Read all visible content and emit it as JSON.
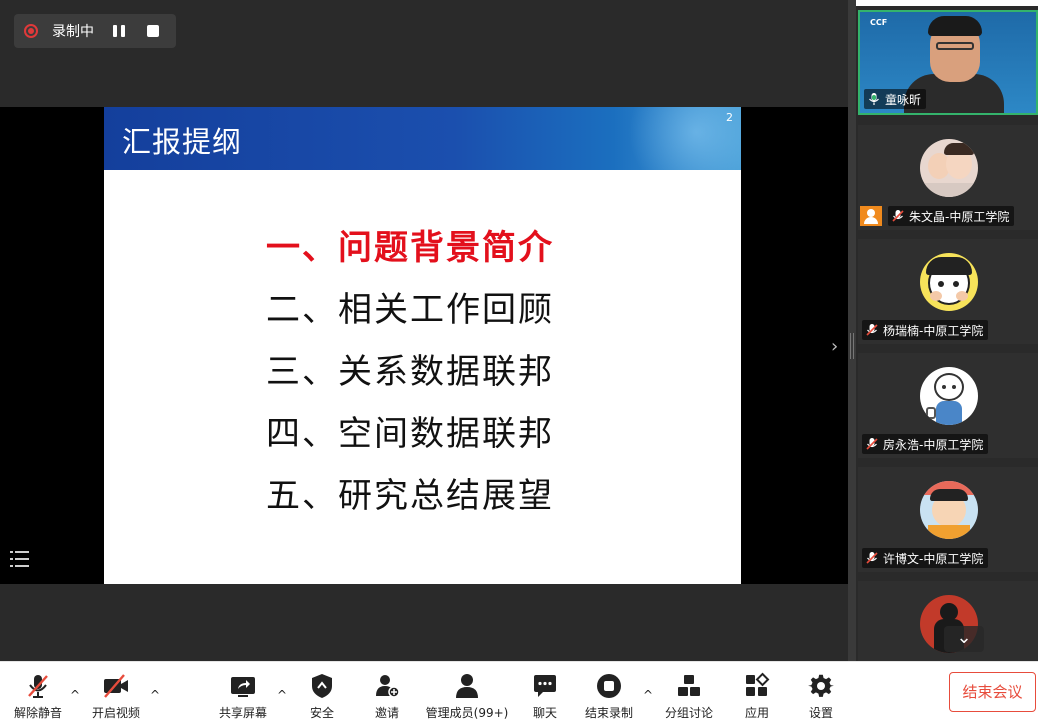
{
  "recording": {
    "status_label": "录制中",
    "pause_icon": "pause-icon",
    "stop_icon": "stop-icon",
    "indicator_color": "#e0393a"
  },
  "slide": {
    "title": "汇报提纲",
    "page_number": "2",
    "items": [
      {
        "text": "一、问题背景简介",
        "active": true
      },
      {
        "text": "二、相关工作回顾",
        "active": false
      },
      {
        "text": "三、关系数据联邦",
        "active": false
      },
      {
        "text": "四、空间数据联邦",
        "active": false
      },
      {
        "text": "五、研究总结展望",
        "active": false
      }
    ],
    "active_color": "#e3101c",
    "header_color": "#1b4fae"
  },
  "participants": [
    {
      "name": "童咏昕",
      "mic": "on",
      "speaking": true,
      "logo_text": "CCF"
    },
    {
      "name": "朱文晶-中原工学院",
      "mic": "muted",
      "host": true
    },
    {
      "name": "杨瑞楠-中原工学院",
      "mic": "muted"
    },
    {
      "name": "房永浩-中原工学院",
      "mic": "muted"
    },
    {
      "name": "许博文-中原工学院",
      "mic": "muted"
    }
  ],
  "toolbar": {
    "unmute": "解除静音",
    "start_video": "开启视频",
    "share_screen": "共享屏幕",
    "security": "安全",
    "invite": "邀请",
    "manage_members": "管理成员(99+)",
    "chat": "聊天",
    "end_recording": "结束录制",
    "breakout": "分组讨论",
    "apps": "应用",
    "settings": "设置",
    "end_meeting": "结束会议"
  },
  "colors": {
    "speaking_border": "#34b36c",
    "end_meeting": "#e74c3c",
    "host_badge": "#f08a1d"
  }
}
